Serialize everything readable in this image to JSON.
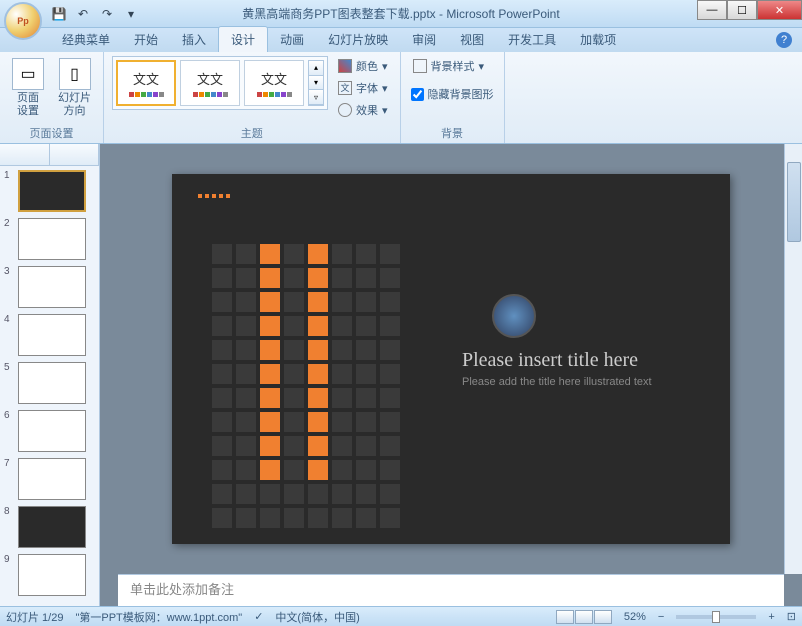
{
  "titlebar": {
    "title": "黄黑高端商务PPT图表整套下载.pptx - Microsoft PowerPoint",
    "office_logo": "Pp"
  },
  "tabs": {
    "items": [
      "经典菜单",
      "开始",
      "插入",
      "设计",
      "动画",
      "幻灯片放映",
      "审阅",
      "视图",
      "开发工具",
      "加载项"
    ],
    "active_index": 3
  },
  "ribbon": {
    "page_setup": {
      "page_setup_label": "页面\n设置",
      "orientation_label": "幻灯片\n方向",
      "group_label": "页面设置"
    },
    "themes": {
      "group_label": "主题",
      "colors_label": "颜色",
      "fonts_label": "字体",
      "effects_label": "效果",
      "theme_aa": "文文"
    },
    "background": {
      "group_label": "背景",
      "styles_label": "背景样式",
      "hide_label": "隐藏背景图形",
      "hide_checked": true
    }
  },
  "thumbs": {
    "count": 9,
    "selected": 1
  },
  "slide": {
    "title": "Please insert title here",
    "subtitle": "Please add the title here illustrated text"
  },
  "notes": {
    "placeholder": "单击此处添加备注"
  },
  "status": {
    "slide_info": "幻灯片 1/29",
    "site": "\"第一PPT模板网：www.1ppt.com\"",
    "lang": "中文(简体，中国)",
    "zoom": "52%"
  }
}
